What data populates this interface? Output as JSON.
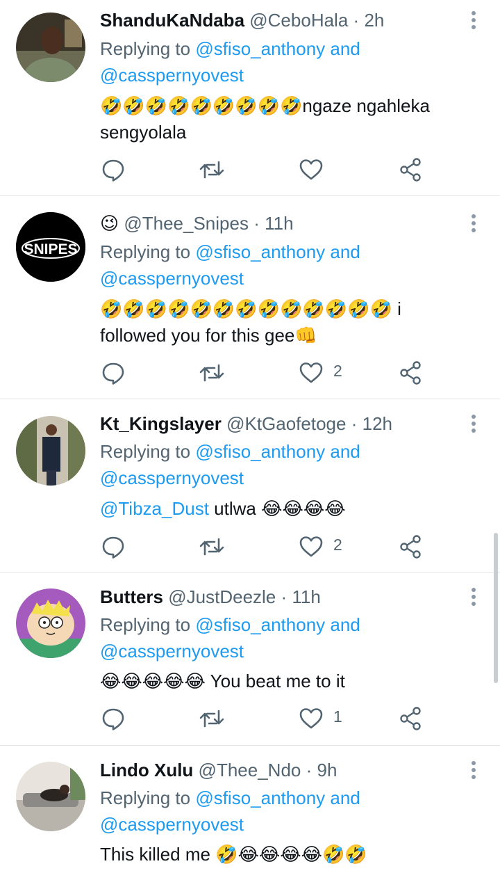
{
  "tweets": [
    {
      "name": "ShanduKaNdaba",
      "handle": "@CeboHala",
      "sep": "·",
      "time": "2h",
      "replying_prefix": "Replying to",
      "replying_user1": "@sfiso_anthony",
      "replying_and": "and",
      "replying_user2": "@casspernyovest",
      "text": "🤣🤣🤣🤣🤣🤣🤣🤣🤣ngaze ngahleka sengyolala",
      "likes": ""
    },
    {
      "name": "😉",
      "handle": "@Thee_Snipes",
      "sep": "·",
      "time": "11h",
      "replying_prefix": "Replying to",
      "replying_user1": "@sfiso_anthony",
      "replying_and": "and",
      "replying_user2": "@casspernyovest",
      "text": "🤣🤣🤣🤣🤣🤣🤣🤣🤣🤣🤣🤣🤣 i followed you for this gee👊",
      "likes": "2",
      "avatar_text": "SNIPES"
    },
    {
      "name": "Kt_Kingslayer",
      "handle": "@KtGaofetoge",
      "sep": "·",
      "time": "12h",
      "replying_prefix": "Replying to",
      "replying_user1": "@sfiso_anthony",
      "replying_and": "and",
      "replying_user2": "@casspernyovest",
      "text_mention": "@Tibza_Dust",
      "text": " utlwa 😂😂😂😂",
      "likes": "2"
    },
    {
      "name": "Butters",
      "handle": "@JustDeezle",
      "sep": "·",
      "time": "11h",
      "replying_prefix": "Replying to",
      "replying_user1": "@sfiso_anthony",
      "replying_and": "and",
      "replying_user2": "@casspernyovest",
      "text": "😂😂😂😂😂 You beat me to it",
      "likes": "1"
    },
    {
      "name": "Lindo Xulu",
      "handle": "@Thee_Ndo",
      "sep": "·",
      "time": "9h",
      "replying_prefix": "Replying to",
      "replying_user1": "@sfiso_anthony",
      "replying_and": "and",
      "replying_user2": "@casspernyovest",
      "text": "This killed me 🤣😂😂😂😂🤣🤣",
      "likes": ""
    }
  ],
  "colors": {
    "link": "#1d9bf0",
    "secondary": "#536471",
    "divider": "#dfe3e6"
  },
  "icons": [
    "reply-icon",
    "retweet-icon",
    "like-icon",
    "share-icon",
    "more-icon"
  ]
}
